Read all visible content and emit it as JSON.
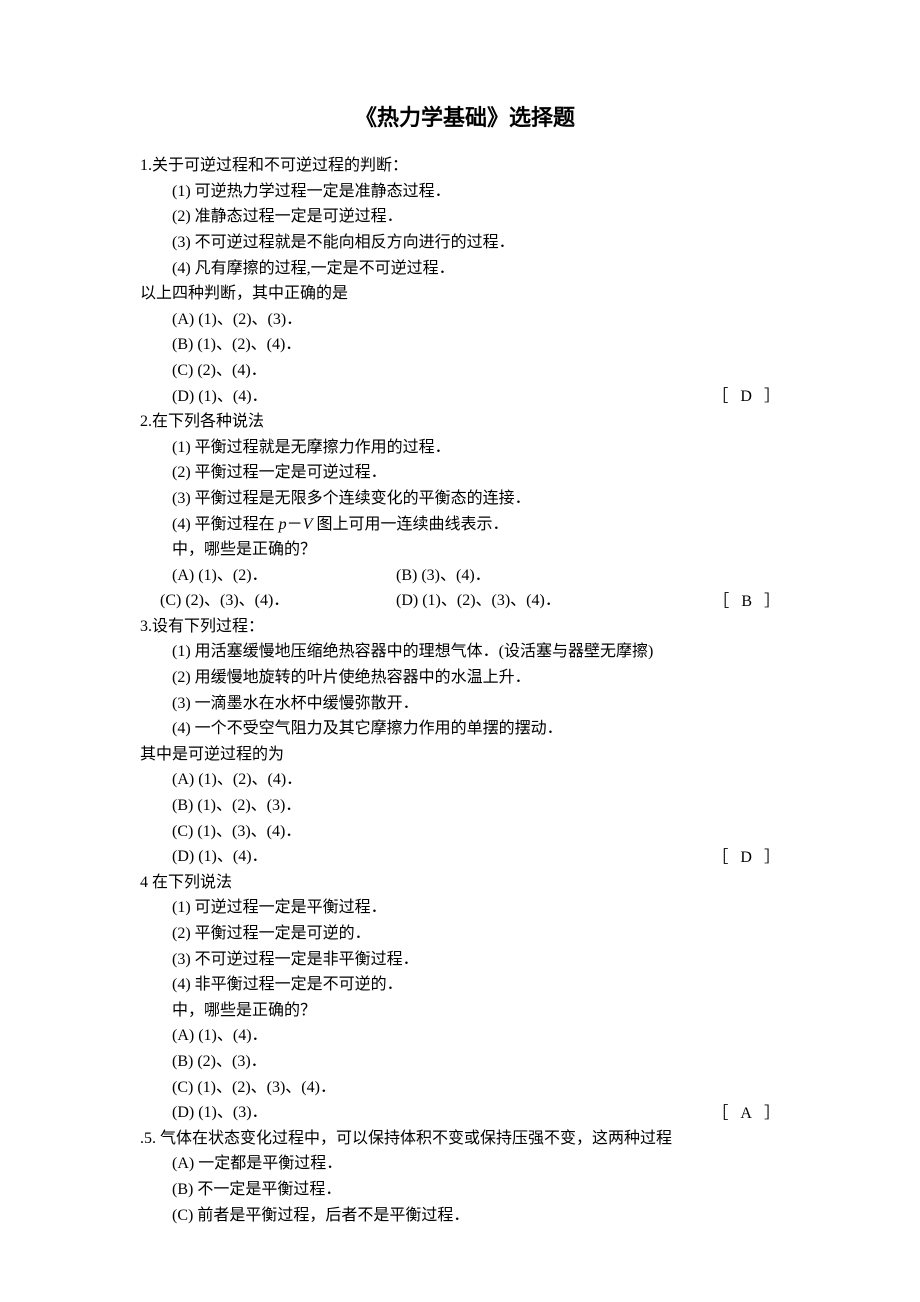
{
  "title": "《热力学基础》选择题",
  "q1": {
    "stem": "1.关于可逆过程和不可逆过程的判断：",
    "s1": "(1) 可逆热力学过程一定是准静态过程．",
    "s2": "(2) 准静态过程一定是可逆过程．",
    "s3": "(3) 不可逆过程就是不能向相反方向进行的过程．",
    "s4": "(4) 凡有摩擦的过程,一定是不可逆过程．",
    "mid": "以上四种判断，其中正确的是",
    "a": "(A)    (1)、(2)、(3)．",
    "b": "(B)    (1)、(2)、(4)．",
    "c": "(C)      (2)、(4)．",
    "d": "(D)     (1)、(4)．",
    "ans": "D"
  },
  "q2": {
    "stem": "2.在下列各种说法",
    "s1": "(1) 平衡过程就是无摩擦力作用的过程．",
    "s2": "(2) 平衡过程一定是可逆过程．",
    "s3": "(3) 平衡过程是无限多个连续变化的平衡态的连接．",
    "s4a": "(4) 平衡过程在 ",
    "s4b": "p",
    "s4c": "－",
    "s4d": "V",
    "s4e": " 图上可用一连续曲线表示．",
    "mid": " 中，哪些是正确的？",
    "a": " (A)   (1)、(2)．",
    "b": "(B)    (3)、(4)．",
    "c": "(C)   (2)、(3)、(4)．",
    "d": "(D)    (1)、(2)、(3)、(4)．",
    "ans": "B"
  },
  "q3": {
    "stem": "3.设有下列过程：",
    "s1": "(1) 用活塞缓慢地压缩绝热容器中的理想气体．(设活塞与器壁无摩擦)",
    "s2": "(2) 用缓慢地旋转的叶片使绝热容器中的水温上升．",
    "s3": "(3) 一滴墨水在水杯中缓慢弥散开．",
    "s4": "(4) 一个不受空气阻力及其它摩擦力作用的单摆的摆动．",
    "mid": "其中是可逆过程的为",
    "a": "(A)   (1)、(2)、(4)．",
    "b": "(B)   (1)、(2)、(3)．",
    "c": "(C)   (1)、(3)、(4)．",
    "d": "(D)   (1)、(4)．",
    "ans": "D"
  },
  "q4": {
    "stem": "4 在下列说法",
    "s1": "(1) 可逆过程一定是平衡过程．",
    "s2": "(2) 平衡过程一定是可逆的．",
    "s3": "(3) 不可逆过程一定是非平衡过程．",
    "s4": "(4) 非平衡过程一定是不可逆的．",
    "mid": " 中，哪些是正确的？",
    "a": " (A)    (1)、(4)．",
    "b": "(B)    (2)、(3)．",
    "c": "(C)    (1)、(2)、(3)、(4)．",
    "d": "(D)    (1)、(3)．",
    "ans": "A"
  },
  "q5": {
    "stem": ".5.        气体在状态变化过程中，可以保持体积不变或保持压强不变，这两种过程",
    "a": "(A) 一定都是平衡过程．",
    "b": "(B) 不一定是平衡过程．",
    "c": "(C) 前者是平衡过程，后者不是平衡过程．"
  }
}
